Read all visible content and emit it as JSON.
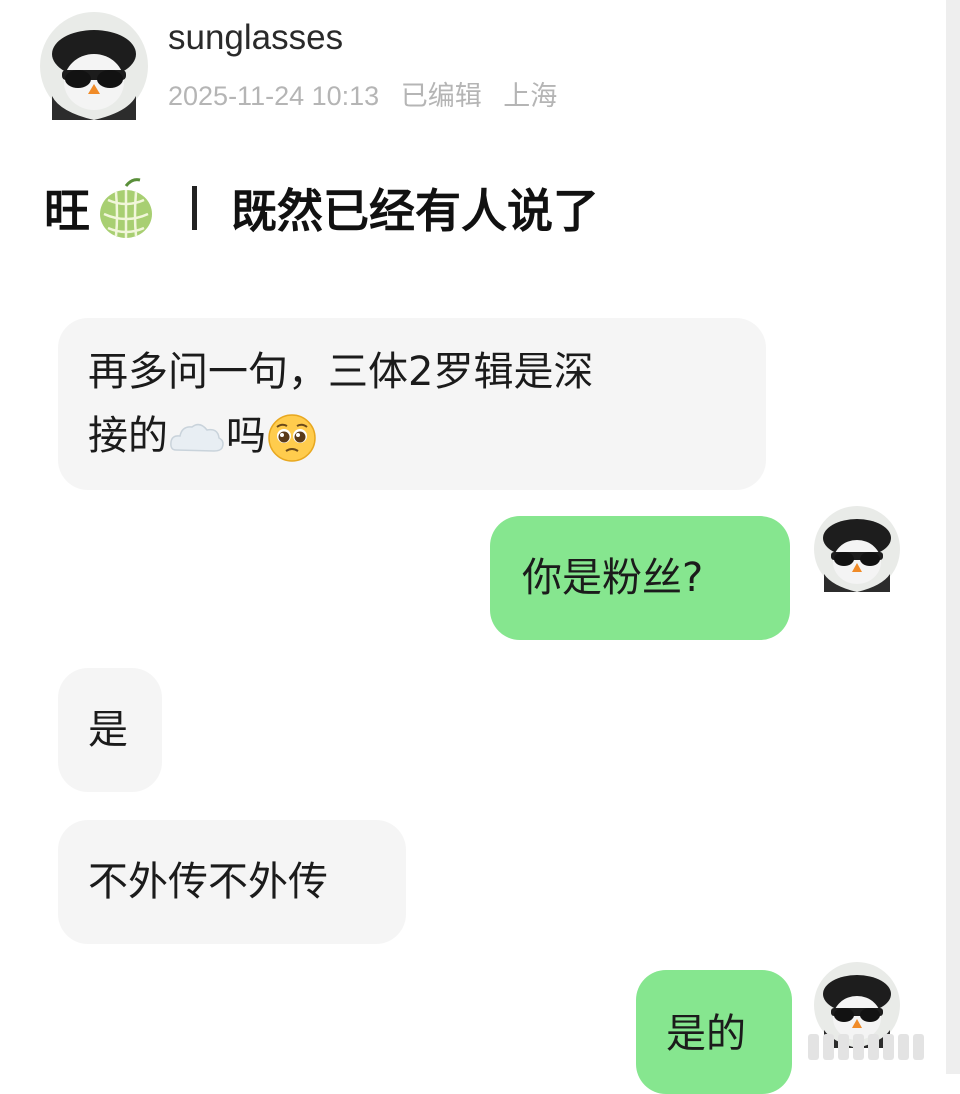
{
  "post": {
    "username": "sunglasses",
    "timestamp": "2025-11-24 10:13",
    "edited": "已编辑",
    "location": "上海"
  },
  "title": {
    "prefix": "旺",
    "emoji": "melon-icon",
    "text": "既然已经有人说了"
  },
  "messages": [
    {
      "side": "left",
      "line1": "再多问一句，三体2罗辑是深",
      "line2_start": "接的",
      "emoji1": "cloud-icon",
      "line2_mid": "吗",
      "emoji2": "pleading-face-icon"
    },
    {
      "side": "right",
      "text": "你是粉丝?"
    },
    {
      "side": "left",
      "text": "是"
    },
    {
      "side": "left",
      "text": "不外传不外传"
    },
    {
      "side": "right",
      "text": "是的"
    }
  ],
  "colors": {
    "incoming_bubble": "#f5f5f5",
    "outgoing_bubble": "#86e68f",
    "meta_text": "#b5b5b5"
  }
}
